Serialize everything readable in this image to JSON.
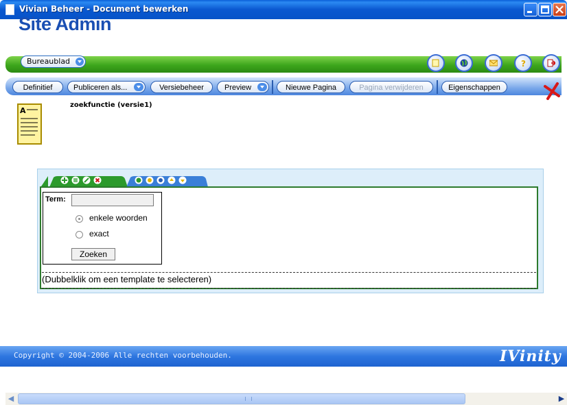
{
  "window": {
    "title": "Vivian Beheer - Document bewerken"
  },
  "header": {
    "brand": "Site Admin",
    "section_dropdown": "Bureaublad",
    "icons": [
      "pages-icon",
      "globe-icon",
      "mail-icon",
      "help-icon",
      "logout-icon"
    ]
  },
  "toolbar": {
    "definitief": "Definitief",
    "publiceren": "Publiceren als...",
    "versiebeheer": "Versiebeheer",
    "preview": "Preview",
    "nieuwe_pagina": "Nieuwe Pagina",
    "pagina_verwijderen": "Pagina verwijderen",
    "eigenschappen": "Eigenschappen"
  },
  "document": {
    "label": "zoekfunctie (versie1)"
  },
  "editor": {
    "tab_icons": [
      "add-icon",
      "list-icon",
      "edit-icon",
      "delete-icon",
      "globe-icon",
      "settings-icon",
      "up-icon",
      "move-up-icon",
      "move-down-icon"
    ],
    "form": {
      "term_label": "Term:",
      "term_value": "",
      "radio_options": [
        {
          "label": "enkele woorden",
          "checked": true
        },
        {
          "label": "exact",
          "checked": false
        }
      ],
      "search_button": "Zoeken"
    },
    "template_hint": "(Dubbelklik om een template te selecteren)"
  },
  "footer": {
    "copyright": "Copyright © 2004-2006 Alle rechten voorbehouden.",
    "logo": "IVinity"
  },
  "colors": {
    "titlebar": "#0a5fd8",
    "brand": "#1a4fb3",
    "green_bar": "#3da61c",
    "toolbar": "#7aa8ea",
    "panel_border": "#2c7a2c",
    "footer": "#2e76e0"
  }
}
